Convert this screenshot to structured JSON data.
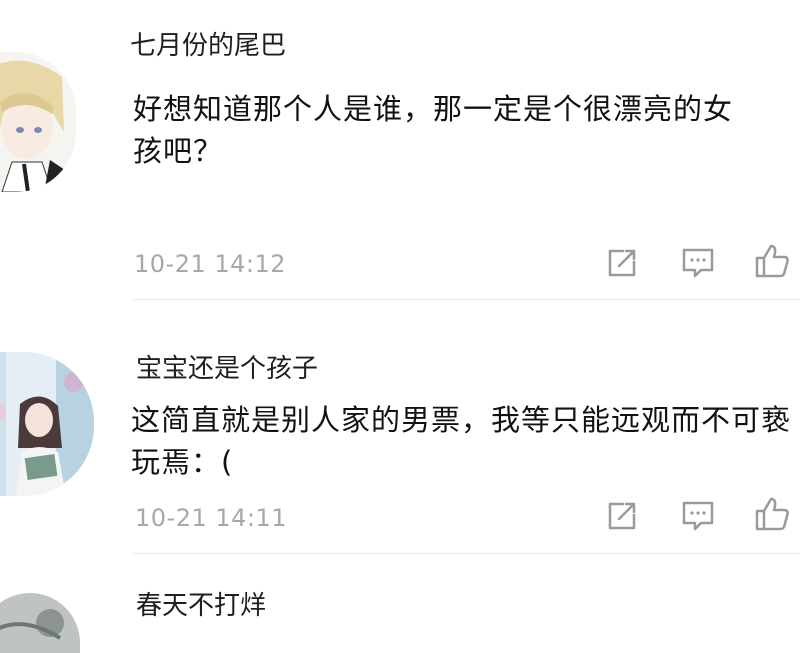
{
  "comments": [
    {
      "username": "七月份的尾巴",
      "text": "好想知道那个人是谁，那一定是个很漂亮的女孩吧？",
      "timestamp": "10-21 14:12",
      "avatar_icon": "anime-boy-avatar"
    },
    {
      "username": "宝宝还是个孩子",
      "text": "这简直就是别人家的男票，我等只能远观而不可亵玩焉：(",
      "timestamp": "10-21 14:11",
      "avatar_icon": "anime-girl-reading-avatar"
    },
    {
      "username": "春天不打烊",
      "avatar_icon": "avatar"
    }
  ],
  "actions": {
    "share_icon": "share-icon",
    "reply_icon": "reply-icon",
    "like_icon": "thumbs-up-icon"
  },
  "colors": {
    "timestamp": "#a8a8a8",
    "icon": "#9a9a9a",
    "divider": "#ececec"
  }
}
